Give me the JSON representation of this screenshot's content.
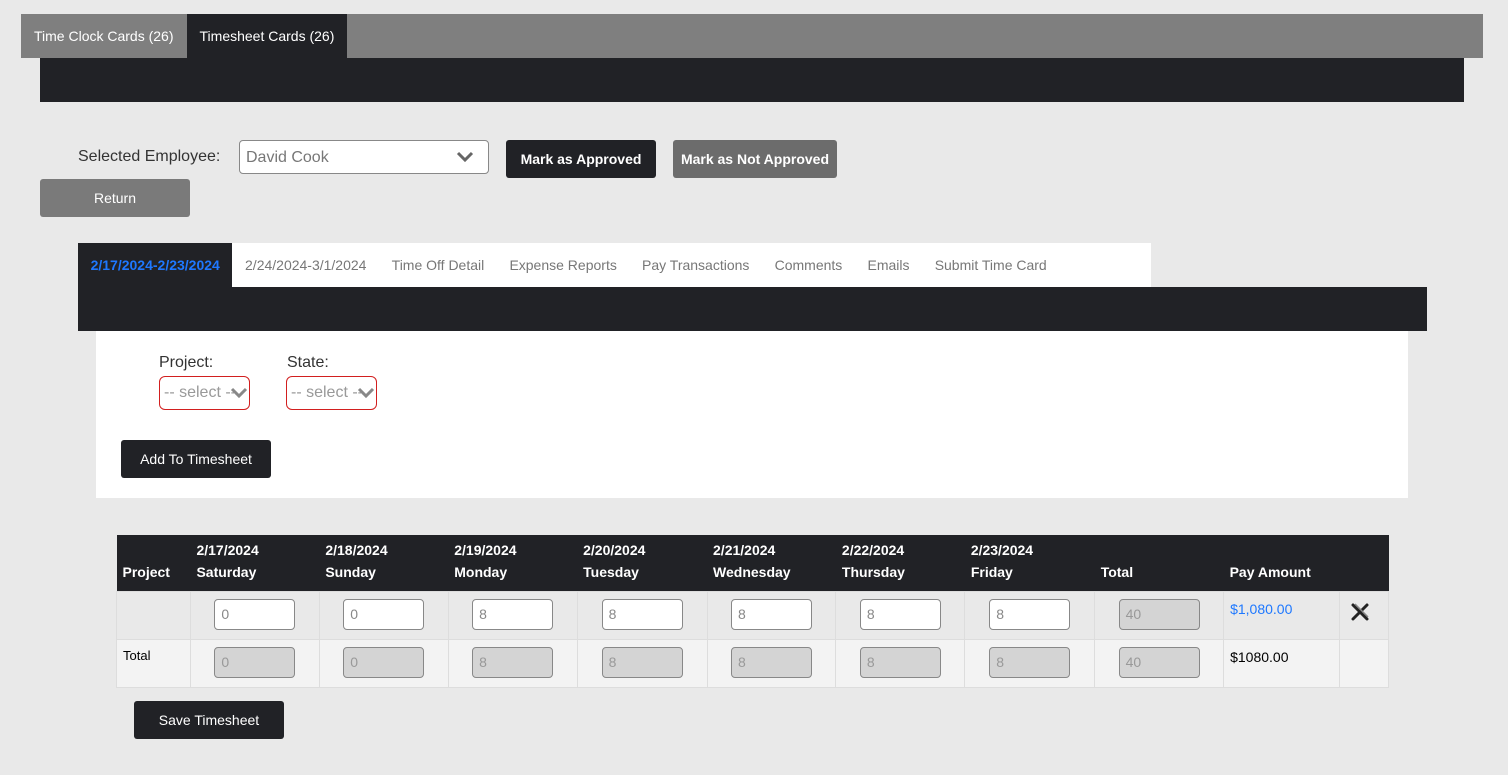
{
  "top_tabs": [
    {
      "label": "Time Clock Cards (26)"
    },
    {
      "label": "Timesheet Cards (26)"
    }
  ],
  "employee": {
    "label": "Selected Employee:",
    "value": "David Cook"
  },
  "buttons": {
    "approve": "Mark as Approved",
    "not_approve": "Mark as Not Approved",
    "return": "Return",
    "add": "Add To Timesheet",
    "save": "Save Timesheet"
  },
  "sub_tabs": [
    {
      "label": "2/17/2024-2/23/2024"
    },
    {
      "label": "2/24/2024-3/1/2024"
    },
    {
      "label": "Time Off Detail"
    },
    {
      "label": "Expense Reports"
    },
    {
      "label": "Pay Transactions"
    },
    {
      "label": "Comments"
    },
    {
      "label": "Emails"
    },
    {
      "label": "Submit Time Card"
    }
  ],
  "form": {
    "project_label": "Project:",
    "project_value": "-- select --",
    "state_label": "State:",
    "state_value": "-- select --"
  },
  "table": {
    "headers": [
      {
        "date": "",
        "label": "Project"
      },
      {
        "date": "2/17/2024",
        "label": "Saturday"
      },
      {
        "date": "2/18/2024",
        "label": "Sunday"
      },
      {
        "date": "2/19/2024",
        "label": "Monday"
      },
      {
        "date": "2/20/2024",
        "label": "Tuesday"
      },
      {
        "date": "2/21/2024",
        "label": "Wednesday"
      },
      {
        "date": "2/22/2024",
        "label": "Thursday"
      },
      {
        "date": "2/23/2024",
        "label": "Friday"
      },
      {
        "date": "",
        "label": "Total"
      },
      {
        "date": "",
        "label": "Pay Amount"
      }
    ],
    "row1": {
      "hours": [
        "0",
        "0",
        "8",
        "8",
        "8",
        "8",
        "8"
      ],
      "total": "40",
      "pay": "$1,080.00"
    },
    "row2": {
      "label": "Total",
      "hours": [
        "0",
        "0",
        "8",
        "8",
        "8",
        "8",
        "8"
      ],
      "total": "40",
      "pay": "$1080.00"
    }
  },
  "colors": {
    "dark": "#212226",
    "accent": "#1e78ff",
    "required_border": "#d21f1f"
  }
}
